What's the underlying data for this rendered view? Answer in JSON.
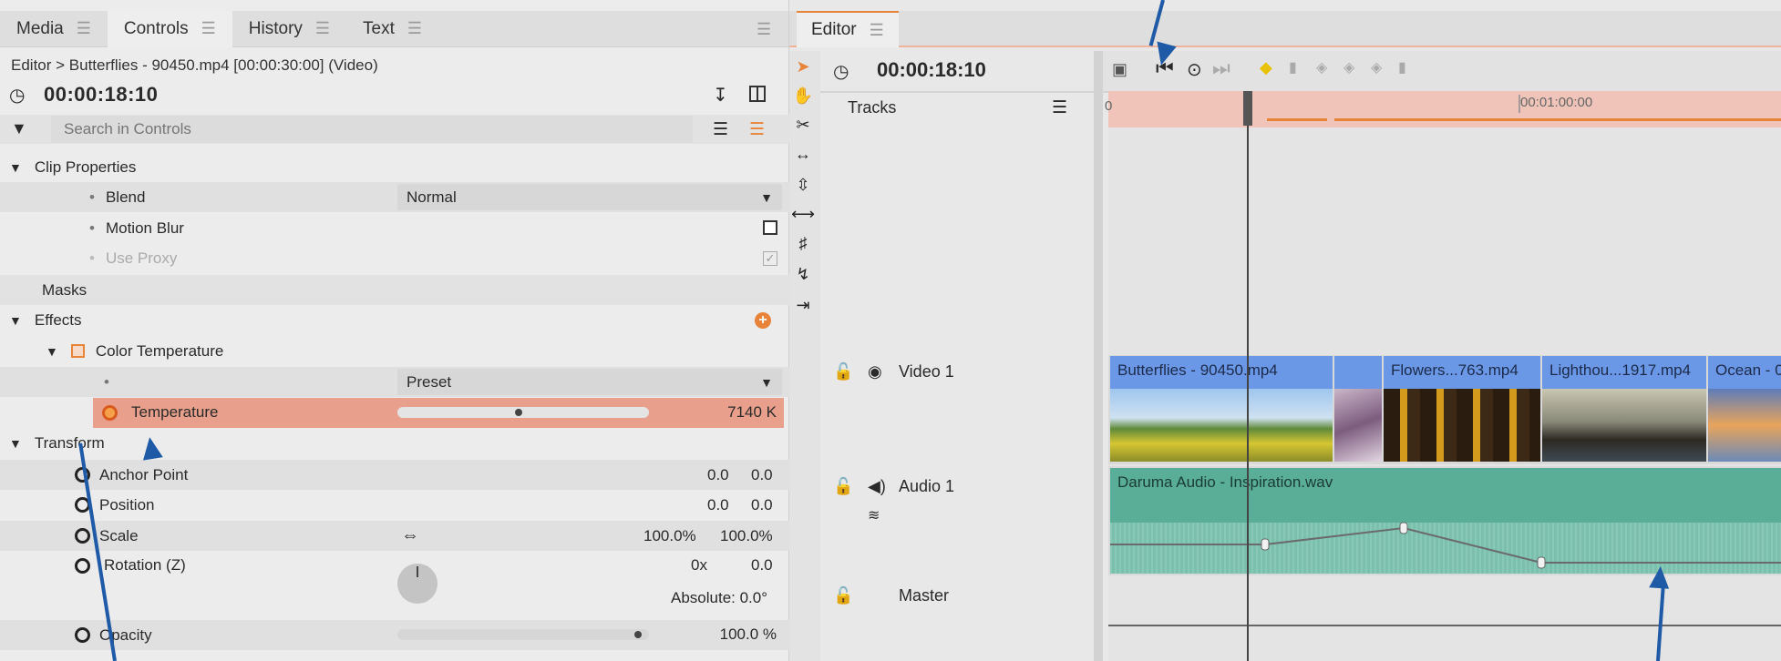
{
  "left_panel": {
    "tabs": [
      {
        "label": "Media"
      },
      {
        "label": "Controls"
      },
      {
        "label": "History"
      },
      {
        "label": "Text"
      }
    ],
    "breadcrumb": "Editor > Butterflies - 90450.mp4 [00:00:30:00] (Video)",
    "timecode": "00:00:18:10",
    "search_placeholder": "Search in Controls",
    "clip_properties": {
      "header": "Clip Properties",
      "blend_label": "Blend",
      "blend_value": "Normal",
      "motion_blur_label": "Motion Blur",
      "use_proxy_label": "Use Proxy"
    },
    "masks_label": "Masks",
    "effects": {
      "header": "Effects",
      "effect_name": "Color Temperature",
      "preset_value": "Preset",
      "temperature_label": "Temperature",
      "temperature_value": "7140 K",
      "temperature_level": 0.48
    },
    "transform": {
      "header": "Transform",
      "anchor_label": "Anchor Point",
      "anchor_x": "0.0",
      "anchor_y": "0.0",
      "position_label": "Position",
      "position_x": "0.0",
      "position_y": "0.0",
      "scale_label": "Scale",
      "scale_x": "100.0%",
      "scale_y": "100.0%",
      "rotation_label": "Rotation (Z)",
      "rotation_turns": "0x",
      "rotation_value": "0.0",
      "rotation_absolute": "Absolute: 0.0°",
      "opacity_label": "Opacity",
      "opacity_value": "100.0 %",
      "opacity_level": 1.0
    }
  },
  "editor": {
    "tab_label": "Editor",
    "timecode": "00:00:18:10",
    "tracks_label": "Tracks",
    "ruler_start": "0",
    "ruler_mark": "00:01:00:00",
    "video_track_label": "Video 1",
    "audio_track_label": "Audio 1",
    "master_track_label": "Master",
    "clips": [
      {
        "label": "Butterflies - 90450.mp4"
      },
      {
        "label": "Flowers...763.mp4"
      },
      {
        "label": "Lighthou...1917.mp4"
      },
      {
        "label": "Ocean - 0"
      }
    ],
    "audio_clip_label": "Daruma Audio - Inspiration.wav"
  },
  "colors": {
    "accent": "#e8843a",
    "selected_row": "#e8a08c",
    "ruler_bg": "#f0c4b8",
    "video_clip_blue": "#6b98e6",
    "audio_clip_teal": "#5aad96",
    "annotation_arrow": "#1f5aa6"
  }
}
